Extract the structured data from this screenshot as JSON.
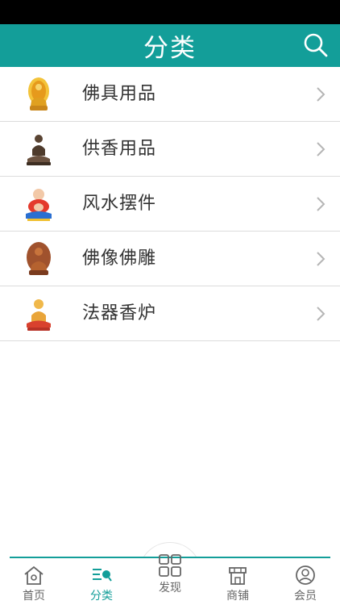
{
  "header": {
    "title": "分类",
    "search_icon": "search-icon",
    "bg_color": "#139e99"
  },
  "categories": [
    {
      "label": "佛具用品",
      "thumb": "gold-buddha-figurine"
    },
    {
      "label": "供香用品",
      "thumb": "bronze-buddha-figurine"
    },
    {
      "label": "风水摆件",
      "thumb": "laughing-buddha-figurine"
    },
    {
      "label": "佛像佛雕",
      "thumb": "carved-buddha-figurine"
    },
    {
      "label": "法器香炉",
      "thumb": "seated-buddha-figurine"
    }
  ],
  "tabbar": {
    "accent_color": "#139e99",
    "items": [
      {
        "label": "首页",
        "icon": "home-icon",
        "active": false
      },
      {
        "label": "分类",
        "icon": "category-icon",
        "active": true
      },
      {
        "label": "发现",
        "icon": "grid-icon",
        "active": false
      },
      {
        "label": "商铺",
        "icon": "store-icon",
        "active": false
      },
      {
        "label": "会员",
        "icon": "user-icon",
        "active": false
      }
    ]
  }
}
